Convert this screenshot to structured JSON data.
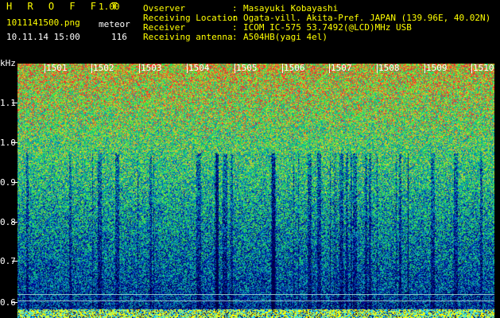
{
  "header": {
    "app_title": "H R O F F T",
    "version": "1.00",
    "filename": "1011141500.png",
    "count_label": "meteor",
    "datetime": "10.11.14 15:00",
    "count_value": "116"
  },
  "info": [
    {
      "label": "Ovserver",
      "sep": ":",
      "value": "Masayuki Kobayashi"
    },
    {
      "label": "Receiving Location",
      "sep": ":",
      "value": "Ogata-vill. Akita-Pref. JAPAN (139.96E, 40.02N)"
    },
    {
      "label": "Receiver",
      "sep": ":",
      "value": "ICOM IC-575 53.7492(@LCD)MHz USB"
    },
    {
      "label": "Receiving antenna",
      "sep": ":",
      "value": "A504HB(yagi 4el)"
    }
  ],
  "spectrogram": {
    "y_unit": "kHz",
    "y_ticks": [
      "1.1",
      "1.0",
      "0.9",
      "0.8",
      "0.7",
      "0.6"
    ],
    "x_ticks": [
      "1501",
      "1502",
      "1503",
      "1504",
      "1505",
      "1506",
      "1507",
      "1508",
      "1509",
      "1510"
    ],
    "colors": {
      "low": "#0a1a8a",
      "mid": "#1aa0c8",
      "high": "#40ff40",
      "peak": "#ff3030",
      "floor": "#ffff00"
    }
  }
}
